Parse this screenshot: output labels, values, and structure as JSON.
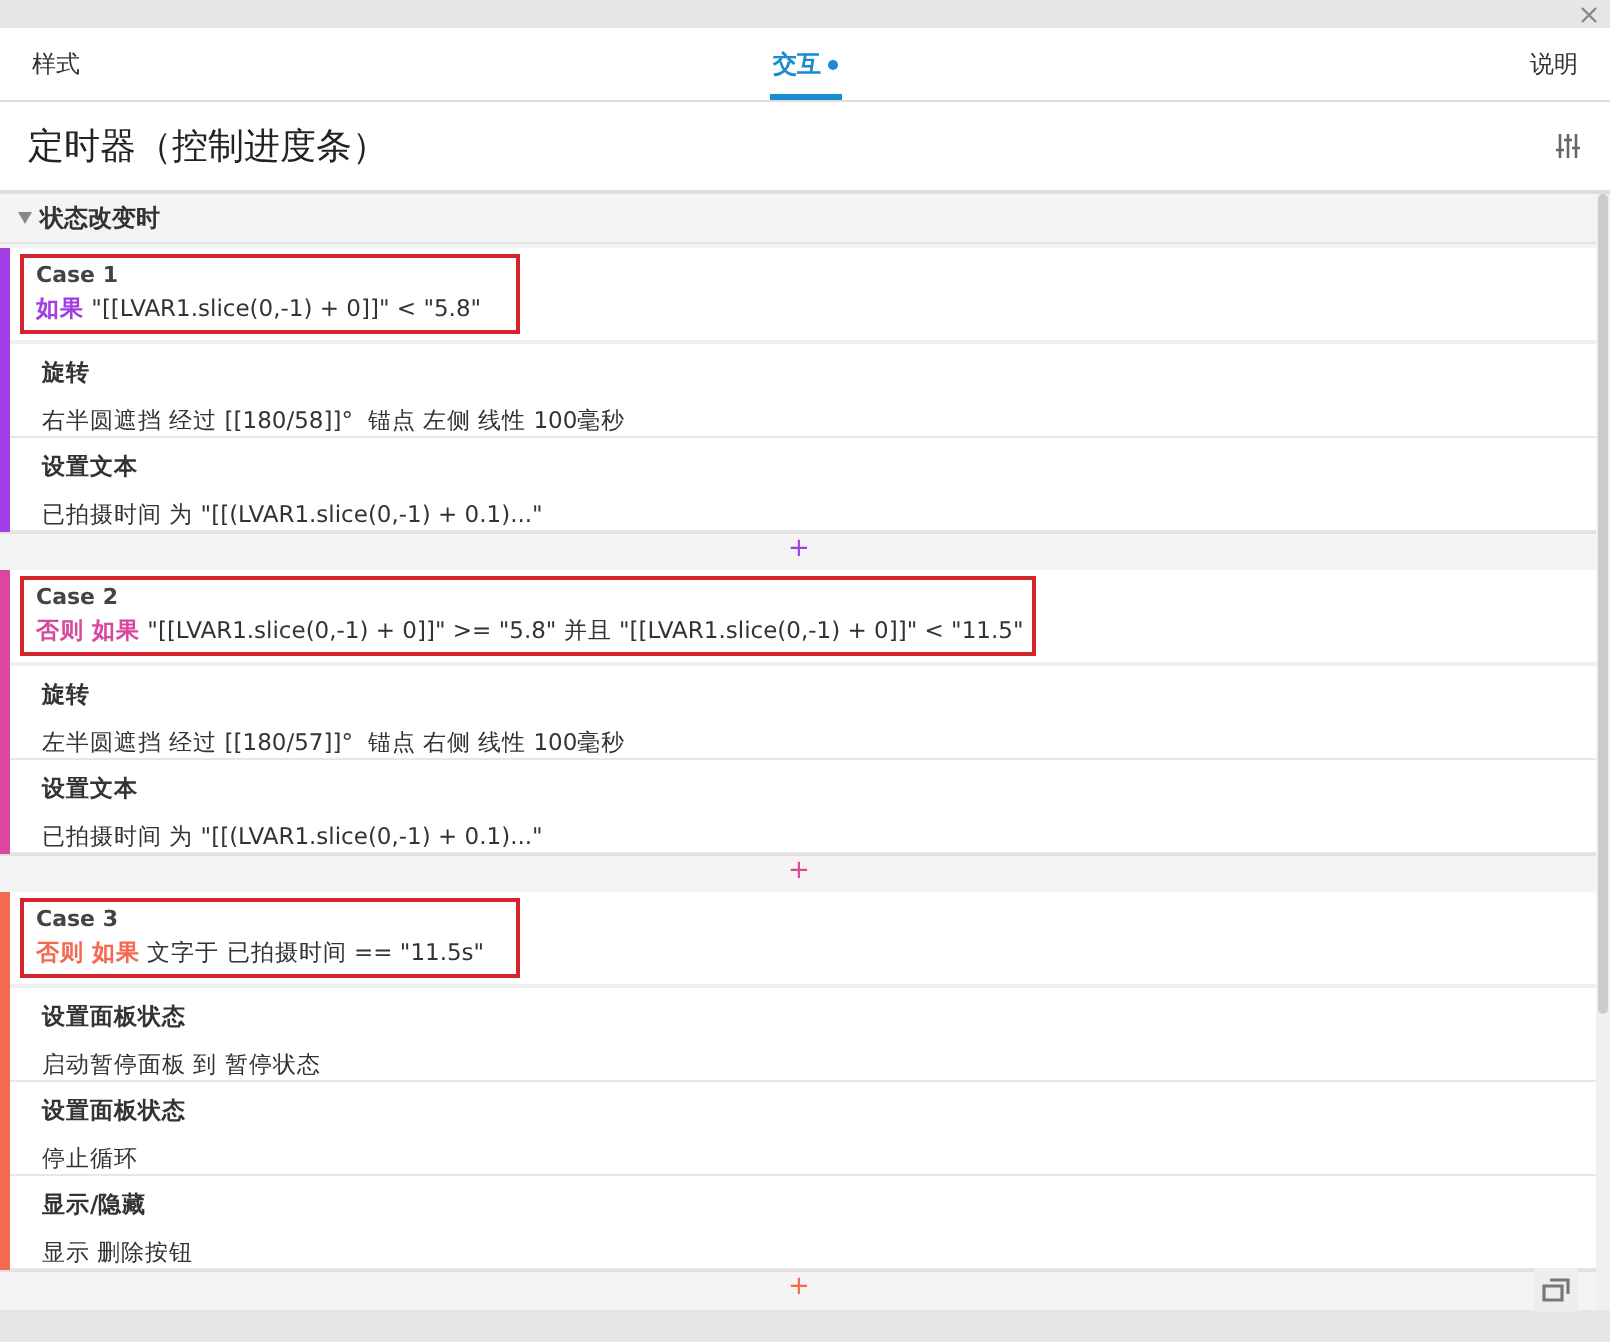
{
  "tabs": [
    {
      "label": "样式",
      "selected": false,
      "dot": false
    },
    {
      "label": "交互",
      "selected": true,
      "dot": true
    },
    {
      "label": "说明",
      "selected": false,
      "dot": false
    }
  ],
  "title": "定时器（控制进度条）",
  "section": {
    "label": "状态改变时",
    "expanded": true
  },
  "cases": [
    {
      "name": "Case 1",
      "color": "#a23ee6",
      "keyword": "如果",
      "condition": "\"[[LVAR1.slice(0,-1) + 0]]\" < \"5.8\"",
      "actions": [
        {
          "name": "旋转",
          "detail": "右半圆遮挡 经过 [[180/58]]°  锚点 左侧 线性 100毫秒"
        },
        {
          "name": "设置文本",
          "detail": "已拍摄时间 为 \"[[(LVAR1.slice(0,-1) + 0.1)...\""
        }
      ],
      "add": "+"
    },
    {
      "name": "Case 2",
      "color": "#d9479f",
      "keyword": "否则 如果",
      "condition": "\"[[LVAR1.slice(0,-1) + 0]]\" >= \"5.8\" 并且 \"[[LVAR1.slice(0,-1) + 0]]\" < \"11.5\"",
      "actions": [
        {
          "name": "旋转",
          "detail": "左半圆遮挡 经过 [[180/57]]°  锚点 右侧 线性 100毫秒"
        },
        {
          "name": "设置文本",
          "detail": "已拍摄时间 为 \"[[(LVAR1.slice(0,-1) + 0.1)...\""
        }
      ],
      "add": "+"
    },
    {
      "name": "Case 3",
      "color": "#f46a50",
      "keyword": "否则 如果",
      "condition": "文字于 已拍摄时间 == \"11.5s\"",
      "actions": [
        {
          "name": "设置面板状态",
          "detail": "启动暂停面板 到 暂停状态"
        },
        {
          "name": "设置面板状态",
          "detail": "停止循环"
        },
        {
          "name": "显示/隐藏",
          "detail": "显示 删除按钮"
        }
      ],
      "add": "+"
    }
  ]
}
